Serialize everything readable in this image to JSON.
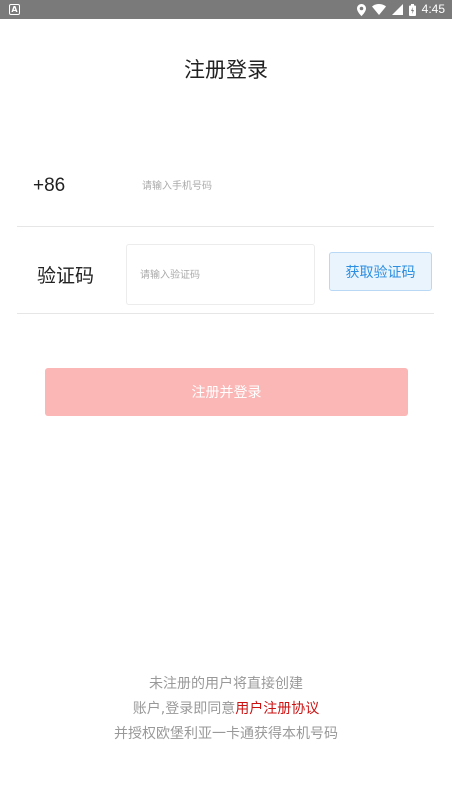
{
  "status_bar": {
    "notification_icon": "a-box-icon",
    "time": "4:45",
    "icons": [
      "location-icon",
      "wifi-icon",
      "cellular-icon",
      "battery-icon"
    ]
  },
  "header": {
    "title": "注册登录"
  },
  "phone": {
    "country_code": "+86",
    "placeholder": "请输入手机号码",
    "value": ""
  },
  "verification": {
    "label": "验证码",
    "placeholder": "请输入验证码",
    "value": "",
    "get_code_label": "获取验证码"
  },
  "submit": {
    "label": "注册并登录"
  },
  "footer": {
    "line1": "未注册的用户将直接创建",
    "line2_prefix": "账户,登录即同意",
    "agreement_link": "用户注册协议",
    "line3": "并授权欧堡利亚一卡通获得本机号码"
  },
  "colors": {
    "accent_blue": "#2b8ee0",
    "submit_bg": "#fbb6b6",
    "link_red": "#cc1111"
  }
}
